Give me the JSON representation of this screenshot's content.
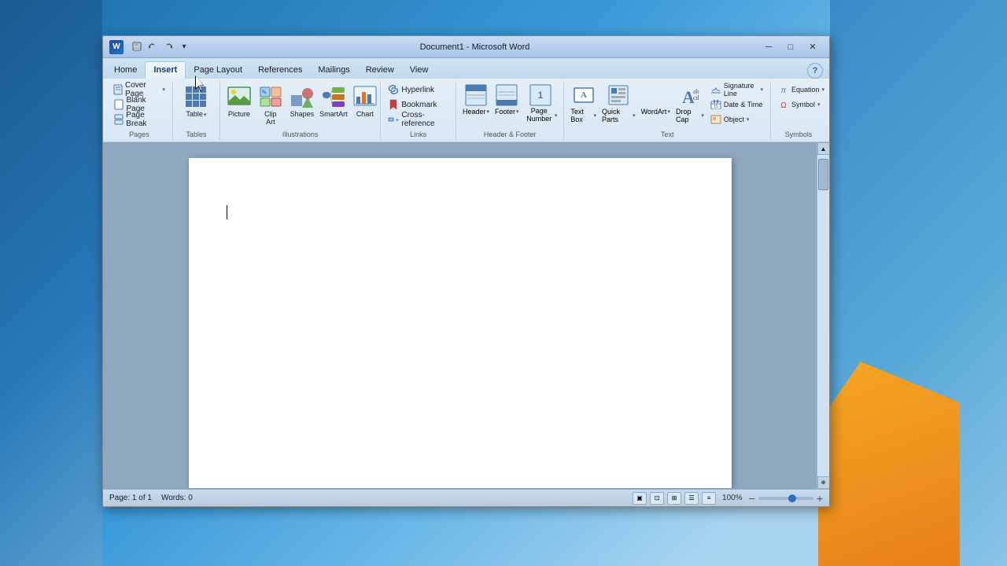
{
  "window": {
    "title": "Document1 - Microsoft Word",
    "word_icon_label": "W"
  },
  "quick_access": {
    "save_label": "💾",
    "undo_label": "↩",
    "redo_label": "↪",
    "dropdown_label": "▾"
  },
  "title_controls": {
    "minimize": "─",
    "maximize": "□",
    "close": "✕"
  },
  "tabs": [
    {
      "label": "Home",
      "active": false
    },
    {
      "label": "Insert",
      "active": true
    },
    {
      "label": "Page Layout",
      "active": false
    },
    {
      "label": "References",
      "active": false
    },
    {
      "label": "Mailings",
      "active": false
    },
    {
      "label": "Review",
      "active": false
    },
    {
      "label": "View",
      "active": false
    }
  ],
  "ribbon": {
    "groups": {
      "pages": {
        "label": "Pages",
        "buttons": [
          {
            "label": "Cover Page",
            "has_dropdown": true
          },
          {
            "label": "Blank Page"
          },
          {
            "label": "Page Break"
          }
        ]
      },
      "tables": {
        "label": "Tables",
        "buttons": [
          {
            "label": "Table",
            "has_dropdown": true
          }
        ]
      },
      "illustrations": {
        "label": "Illustrations",
        "buttons": [
          {
            "label": "Picture"
          },
          {
            "label": "Clip Art"
          },
          {
            "label": "Shapes"
          },
          {
            "label": "SmartArt"
          },
          {
            "label": "Chart"
          }
        ]
      },
      "links": {
        "label": "Links",
        "buttons": [
          {
            "label": "Hyperlink"
          },
          {
            "label": "Bookmark"
          },
          {
            "label": "Cross-reference"
          }
        ]
      },
      "header_footer": {
        "label": "Header & Footer",
        "buttons": [
          {
            "label": "Header",
            "has_dropdown": true
          },
          {
            "label": "Footer",
            "has_dropdown": true
          },
          {
            "label": "Page Number",
            "has_dropdown": true
          }
        ]
      },
      "text": {
        "label": "Text",
        "buttons": [
          {
            "label": "Text Box",
            "has_dropdown": true
          },
          {
            "label": "Quick Parts",
            "has_dropdown": true
          },
          {
            "label": "WordArt",
            "has_dropdown": true
          },
          {
            "label": "Drop Cap",
            "has_dropdown": true
          },
          {
            "label": "Signature Line",
            "has_dropdown": true
          },
          {
            "label": "Date & Time"
          },
          {
            "label": "Object",
            "has_dropdown": true
          }
        ]
      },
      "symbols": {
        "label": "Symbols",
        "buttons": [
          {
            "label": "Equation",
            "has_dropdown": true
          },
          {
            "label": "Symbol",
            "has_dropdown": true
          }
        ]
      }
    }
  },
  "status_bar": {
    "page_info": "Page: 1 of 1",
    "words": "Words: 0",
    "zoom": "100%"
  }
}
